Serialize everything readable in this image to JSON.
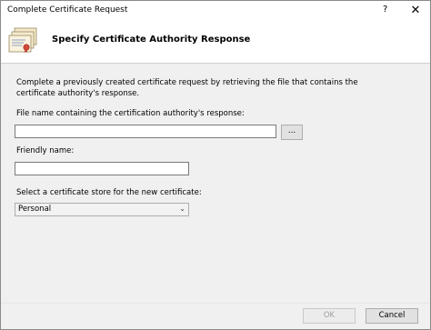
{
  "window": {
    "title": "Complete Certificate Request",
    "help_label": "?",
    "close_label": "✕"
  },
  "header": {
    "title": "Specify Certificate Authority Response",
    "icon": "certificate-icon"
  },
  "form": {
    "description": "Complete a previously created certificate request by retrieving the file that contains the certificate authority's response.",
    "file_label": "File name containing the certification authority's response:",
    "file_value": "",
    "browse_label": "...",
    "friendly_label": "Friendly name:",
    "friendly_value": "",
    "store_label": "Select a certificate store for the new certificate:",
    "store_value": "Personal"
  },
  "footer": {
    "ok_label": "OK",
    "cancel_label": "Cancel"
  }
}
